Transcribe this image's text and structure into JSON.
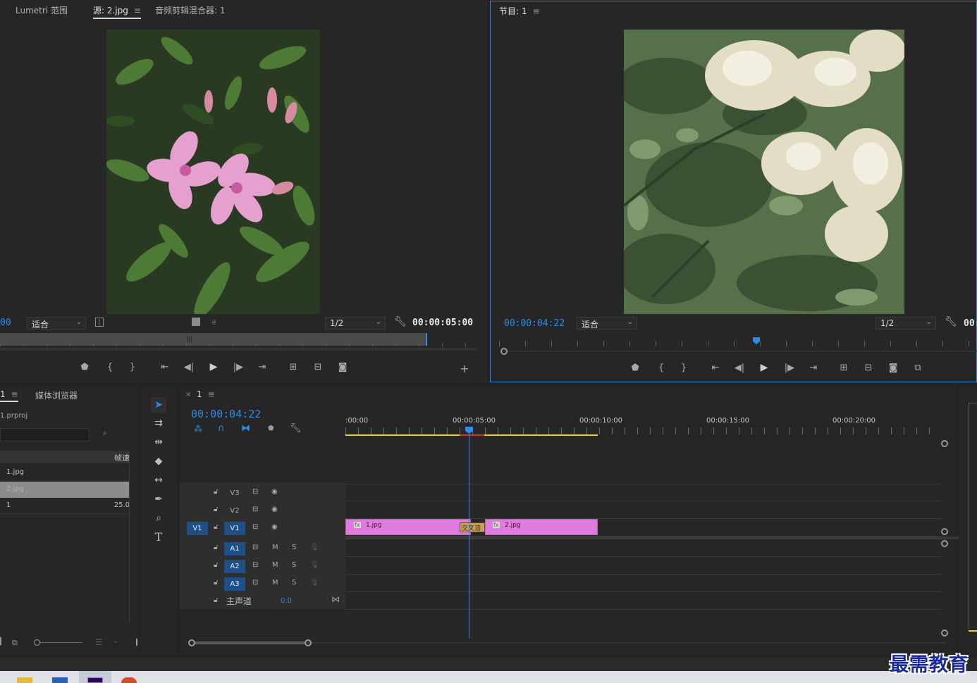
{
  "source_monitor": {
    "tabs": [
      {
        "label": "Lumetri 范围"
      },
      {
        "label": "源: 2.jpg"
      },
      {
        "label": "音频剪辑混合器: 1"
      }
    ],
    "timecode_left": "00",
    "fit_label": "适合",
    "resolution": "1/2",
    "duration": "00:00:05:00"
  },
  "program_monitor": {
    "title": "节目: 1",
    "timecode": "00:00:04:22",
    "fit_label": "适合",
    "resolution": "1/2",
    "duration_partial": "00:"
  },
  "project_panel": {
    "tab_name": "1",
    "media_browser": "媒体浏览器",
    "project_file": "1.prproj",
    "col_header": "帧速",
    "items": [
      {
        "name": "1.jpg",
        "rate": ""
      },
      {
        "name": "2.jpg",
        "rate": ""
      },
      {
        "name": "1",
        "rate": "25.0"
      }
    ]
  },
  "timeline": {
    "sequence_name": "1",
    "timecode": "00:00:04:22",
    "ruler": [
      ":00:00",
      "00:00:05:00",
      "00:00:10:00",
      "00:00:15:00",
      "00:00:20:00"
    ],
    "video_tracks": [
      {
        "name": "V3",
        "target": false
      },
      {
        "name": "V2",
        "target": false
      },
      {
        "name": "V1",
        "target": true,
        "source": "V1"
      }
    ],
    "audio_tracks": [
      {
        "name": "A1",
        "m": "M",
        "s": "S"
      },
      {
        "name": "A2",
        "m": "M",
        "s": "S"
      },
      {
        "name": "A3",
        "m": "M",
        "s": "S"
      }
    ],
    "master": {
      "label": "主声道",
      "value": "0.0"
    },
    "clips": [
      {
        "name": "1.jpg"
      },
      {
        "name": "2.jpg"
      }
    ],
    "transition_label": "交叉溶"
  },
  "watermark": "最需教育",
  "colors": {
    "accent_blue": "#2d8ceb",
    "clip_pink": "#e07ce0",
    "work_area_yellow": "#e8d21a",
    "render_red": "#d0342c"
  }
}
